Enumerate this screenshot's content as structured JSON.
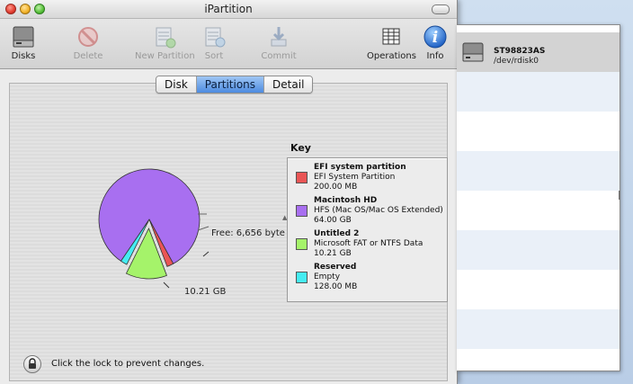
{
  "window": {
    "title": "iPartition"
  },
  "toolbar": {
    "disks": "Disks",
    "delete": "Delete",
    "new_partition": "New Partition",
    "sort": "Sort",
    "commit": "Commit",
    "operations": "Operations",
    "info": "Info"
  },
  "tabs": [
    {
      "label": "Disk",
      "active": false
    },
    {
      "label": "Partitions",
      "active": true
    },
    {
      "label": "Detail",
      "active": false
    }
  ],
  "key": {
    "title": "Key",
    "items": [
      {
        "name": "EFI system partition",
        "type": "EFI System Partition",
        "size": "200.00 MB",
        "color": "#ea5555"
      },
      {
        "name": "Macintosh HD",
        "type": "HFS (Mac OS/Mac OS Extended)",
        "size": "64.00 GB",
        "color": "#a86ff0"
      },
      {
        "name": "Untitled 2",
        "type": "Microsoft FAT or NTFS Data",
        "size": "10.21 GB",
        "color": "#a5f36a"
      },
      {
        "name": "Reserved",
        "type": "Empty",
        "size": "128.00 MB",
        "color": "#45ecf2"
      }
    ]
  },
  "pie": {
    "free_label": "Free: 6,656 byte",
    "size_label": "10.21 GB",
    "slices": [
      {
        "name": "Macintosh HD",
        "value": 64.0,
        "color": "#a86ff0"
      },
      {
        "name": "EFI system partition",
        "value": 0.2,
        "color": "#ea5555"
      },
      {
        "name": "Untitled 2",
        "value": 10.21,
        "color": "#a5f36a"
      },
      {
        "name": "Reserved",
        "value": 0.128,
        "color": "#45ecf2"
      }
    ]
  },
  "lock": {
    "text": "Click the lock to prevent changes."
  },
  "disk_list": [
    {
      "name": "ST98823AS",
      "path": "/dev/rdisk0"
    }
  ]
}
